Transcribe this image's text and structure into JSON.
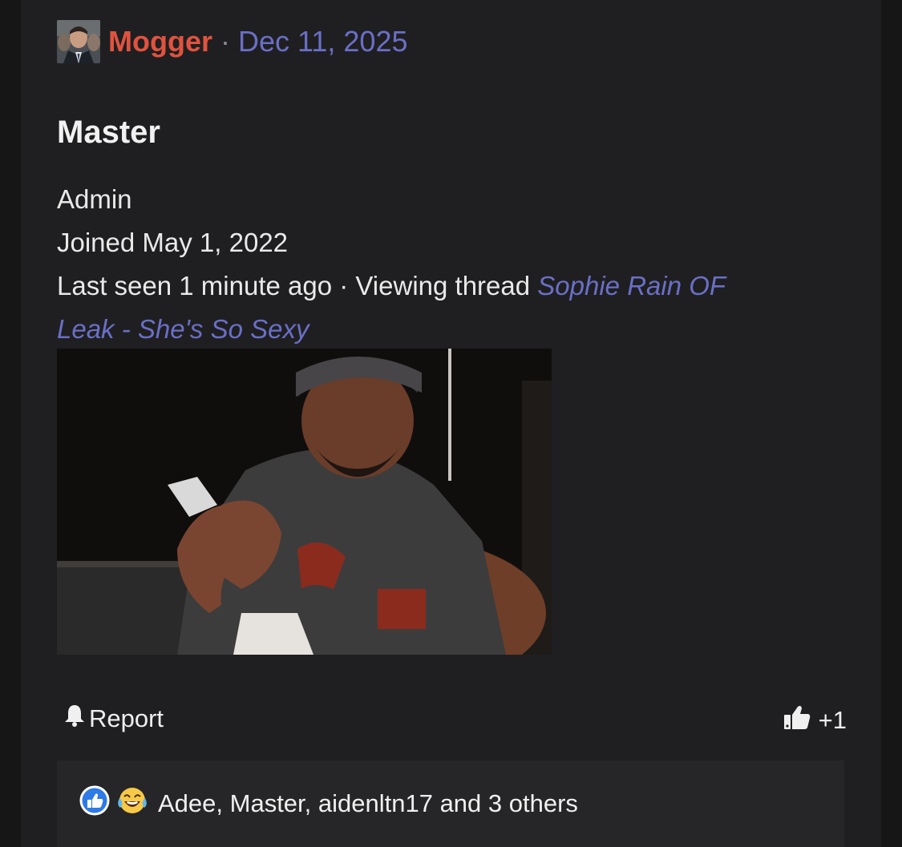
{
  "post": {
    "author": "Mogger",
    "separator": "·",
    "date": "Dec 11, 2025",
    "colors": {
      "author": "#e0533f",
      "link": "#6a6fc6",
      "background": "#1f1f21"
    }
  },
  "profile": {
    "name": "Master",
    "role": "Admin",
    "joined": "Joined May 1, 2022",
    "last_seen": "Last seen 1 minute ago · Viewing thread ",
    "thread_title_part1": "Sophie Rain OF",
    "thread_title_part2": "Leak - She's So Sexy"
  },
  "actions": {
    "report_icon": "bell-icon",
    "report_label": "Report",
    "like_icon": "thumbs-up-icon",
    "like_count": "+1"
  },
  "reactions": {
    "icons": [
      "like-reaction-icon",
      "laughing-crying-emoji-icon"
    ],
    "summary": "Adee, Master, aidenltn17 and 3 others"
  }
}
